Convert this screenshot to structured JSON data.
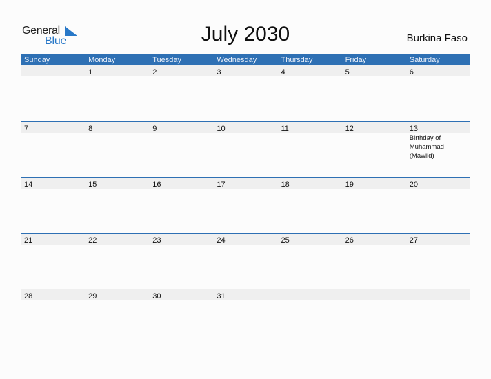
{
  "logo": {
    "text_general": "General",
    "text_blue": "Blue"
  },
  "header": {
    "title": "July 2030",
    "country": "Burkina Faso"
  },
  "weekdays": [
    "Sunday",
    "Monday",
    "Tuesday",
    "Wednesday",
    "Thursday",
    "Friday",
    "Saturday"
  ],
  "weeks": [
    {
      "days": [
        "",
        "1",
        "2",
        "3",
        "4",
        "5",
        "6"
      ],
      "events": [
        "",
        "",
        "",
        "",
        "",
        "",
        ""
      ]
    },
    {
      "days": [
        "7",
        "8",
        "9",
        "10",
        "11",
        "12",
        "13"
      ],
      "events": [
        "",
        "",
        "",
        "",
        "",
        "",
        "Birthday of Muhammad (Mawlid)"
      ]
    },
    {
      "days": [
        "14",
        "15",
        "16",
        "17",
        "18",
        "19",
        "20"
      ],
      "events": [
        "",
        "",
        "",
        "",
        "",
        "",
        ""
      ]
    },
    {
      "days": [
        "21",
        "22",
        "23",
        "24",
        "25",
        "26",
        "27"
      ],
      "events": [
        "",
        "",
        "",
        "",
        "",
        "",
        ""
      ]
    },
    {
      "days": [
        "28",
        "29",
        "30",
        "31",
        "",
        "",
        ""
      ],
      "events": [
        "",
        "",
        "",
        "",
        "",
        "",
        ""
      ]
    }
  ],
  "colors": {
    "header_bar": "#2e70b4",
    "brand_blue": "#2878c8",
    "date_band": "#efefef"
  }
}
